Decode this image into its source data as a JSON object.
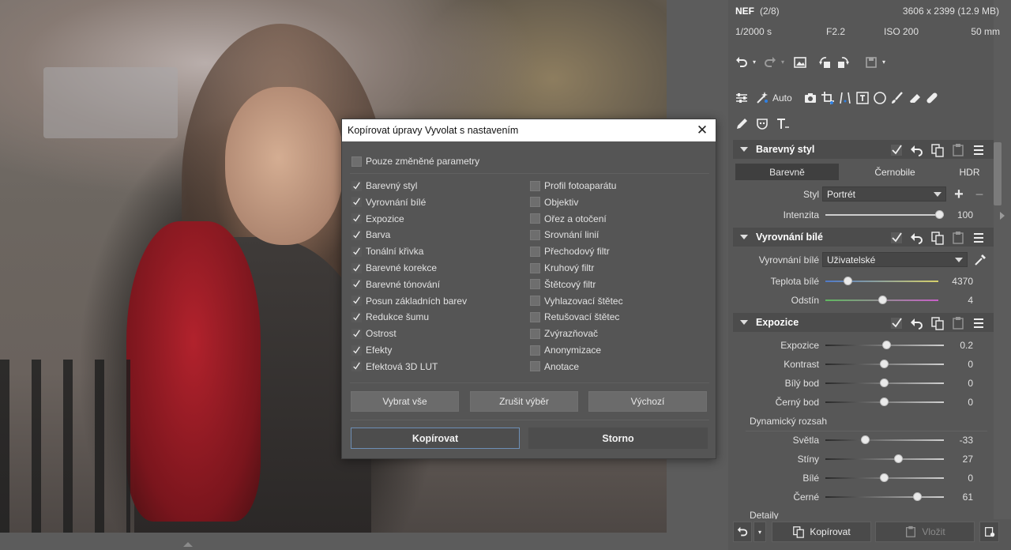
{
  "photo_info": {
    "format": "NEF",
    "index": "(2/8)",
    "resolution": "3606 x 2399 (12.9 MB)",
    "shutter": "1/2000 s",
    "aperture": "F2.2",
    "iso": "ISO 200",
    "focal": "50 mm"
  },
  "toolbar": {
    "auto_label": "Auto"
  },
  "sections": {
    "barevny_styl": {
      "title": "Barevný styl",
      "tabs": [
        "Barevně",
        "Černobile",
        "HDR"
      ],
      "active_tab": 0,
      "style_label": "Styl",
      "style_value": "Portrét",
      "intensity_label": "Intenzita",
      "intensity_value": "100",
      "intensity_level": 1.0
    },
    "vyrovnani_bile": {
      "title": "Vyrovnání bílé",
      "wb_label": "Vyrovnání bílé",
      "wb_value": "Uživatelské",
      "temp_label": "Teplota bílé",
      "temp_value": "4370",
      "temp_level": 0.2,
      "tint_label": "Odstín",
      "tint_value": "4",
      "tint_level": 0.52
    },
    "expozice": {
      "title": "Expozice",
      "sliders": [
        {
          "label": "Expozice",
          "value": "0.2",
          "level": 0.52
        },
        {
          "label": "Kontrast",
          "value": "0",
          "level": 0.5
        },
        {
          "label": "Bílý bod",
          "value": "0",
          "level": 0.5
        },
        {
          "label": "Černý bod",
          "value": "0",
          "level": 0.5
        }
      ],
      "dynamic_label": "Dynamický rozsah",
      "dynamic_sliders": [
        {
          "label": "Světla",
          "value": "-33",
          "level": 0.34
        },
        {
          "label": "Stíny",
          "value": "27",
          "level": 0.62
        },
        {
          "label": "Bílé",
          "value": "0",
          "level": 0.5
        },
        {
          "label": "Černé",
          "value": "61",
          "level": 0.78
        }
      ],
      "details_label": "Detaily"
    }
  },
  "bottom": {
    "copy_label": "Kopírovat",
    "paste_label": "Vložit"
  },
  "dialog": {
    "title": "Kopírovat úpravy Vyvolat s nastavením",
    "only_changed_label": "Pouze změněné parametry",
    "only_changed_checked": false,
    "left_items": [
      {
        "label": "Barevný styl",
        "checked": true
      },
      {
        "label": "Vyrovnání bílé",
        "checked": true
      },
      {
        "label": "Expozice",
        "checked": true
      },
      {
        "label": "Barva",
        "checked": true
      },
      {
        "label": "Tonální křivka",
        "checked": true
      },
      {
        "label": "Barevné korekce",
        "checked": true
      },
      {
        "label": "Barevné tónování",
        "checked": true
      },
      {
        "label": "Posun základních barev",
        "checked": true
      },
      {
        "label": "Redukce šumu",
        "checked": true
      },
      {
        "label": "Ostrost",
        "checked": true
      },
      {
        "label": "Efekty",
        "checked": true
      },
      {
        "label": "Efektová 3D LUT",
        "checked": true
      }
    ],
    "right_items": [
      {
        "label": "Profil fotoaparátu",
        "checked": false
      },
      {
        "label": "Objektiv",
        "checked": false
      },
      {
        "label": "Ořez a otočení",
        "checked": false
      },
      {
        "label": "Srovnání linií",
        "checked": false
      },
      {
        "label": "Přechodový filtr",
        "checked": false
      },
      {
        "label": "Kruhový filtr",
        "checked": false
      },
      {
        "label": "Štětcový filtr",
        "checked": false
      },
      {
        "label": "Vyhlazovací štětec",
        "checked": false
      },
      {
        "label": "Retušovací štětec",
        "checked": false
      },
      {
        "label": "Zvýrazňovač",
        "checked": false
      },
      {
        "label": "Anonymizace",
        "checked": false
      },
      {
        "label": "Anotace",
        "checked": false
      }
    ],
    "select_all_label": "Vybrat vše",
    "deselect_label": "Zrušit výběr",
    "default_label": "Výchozí",
    "copy_label": "Kopírovat",
    "cancel_label": "Storno"
  }
}
